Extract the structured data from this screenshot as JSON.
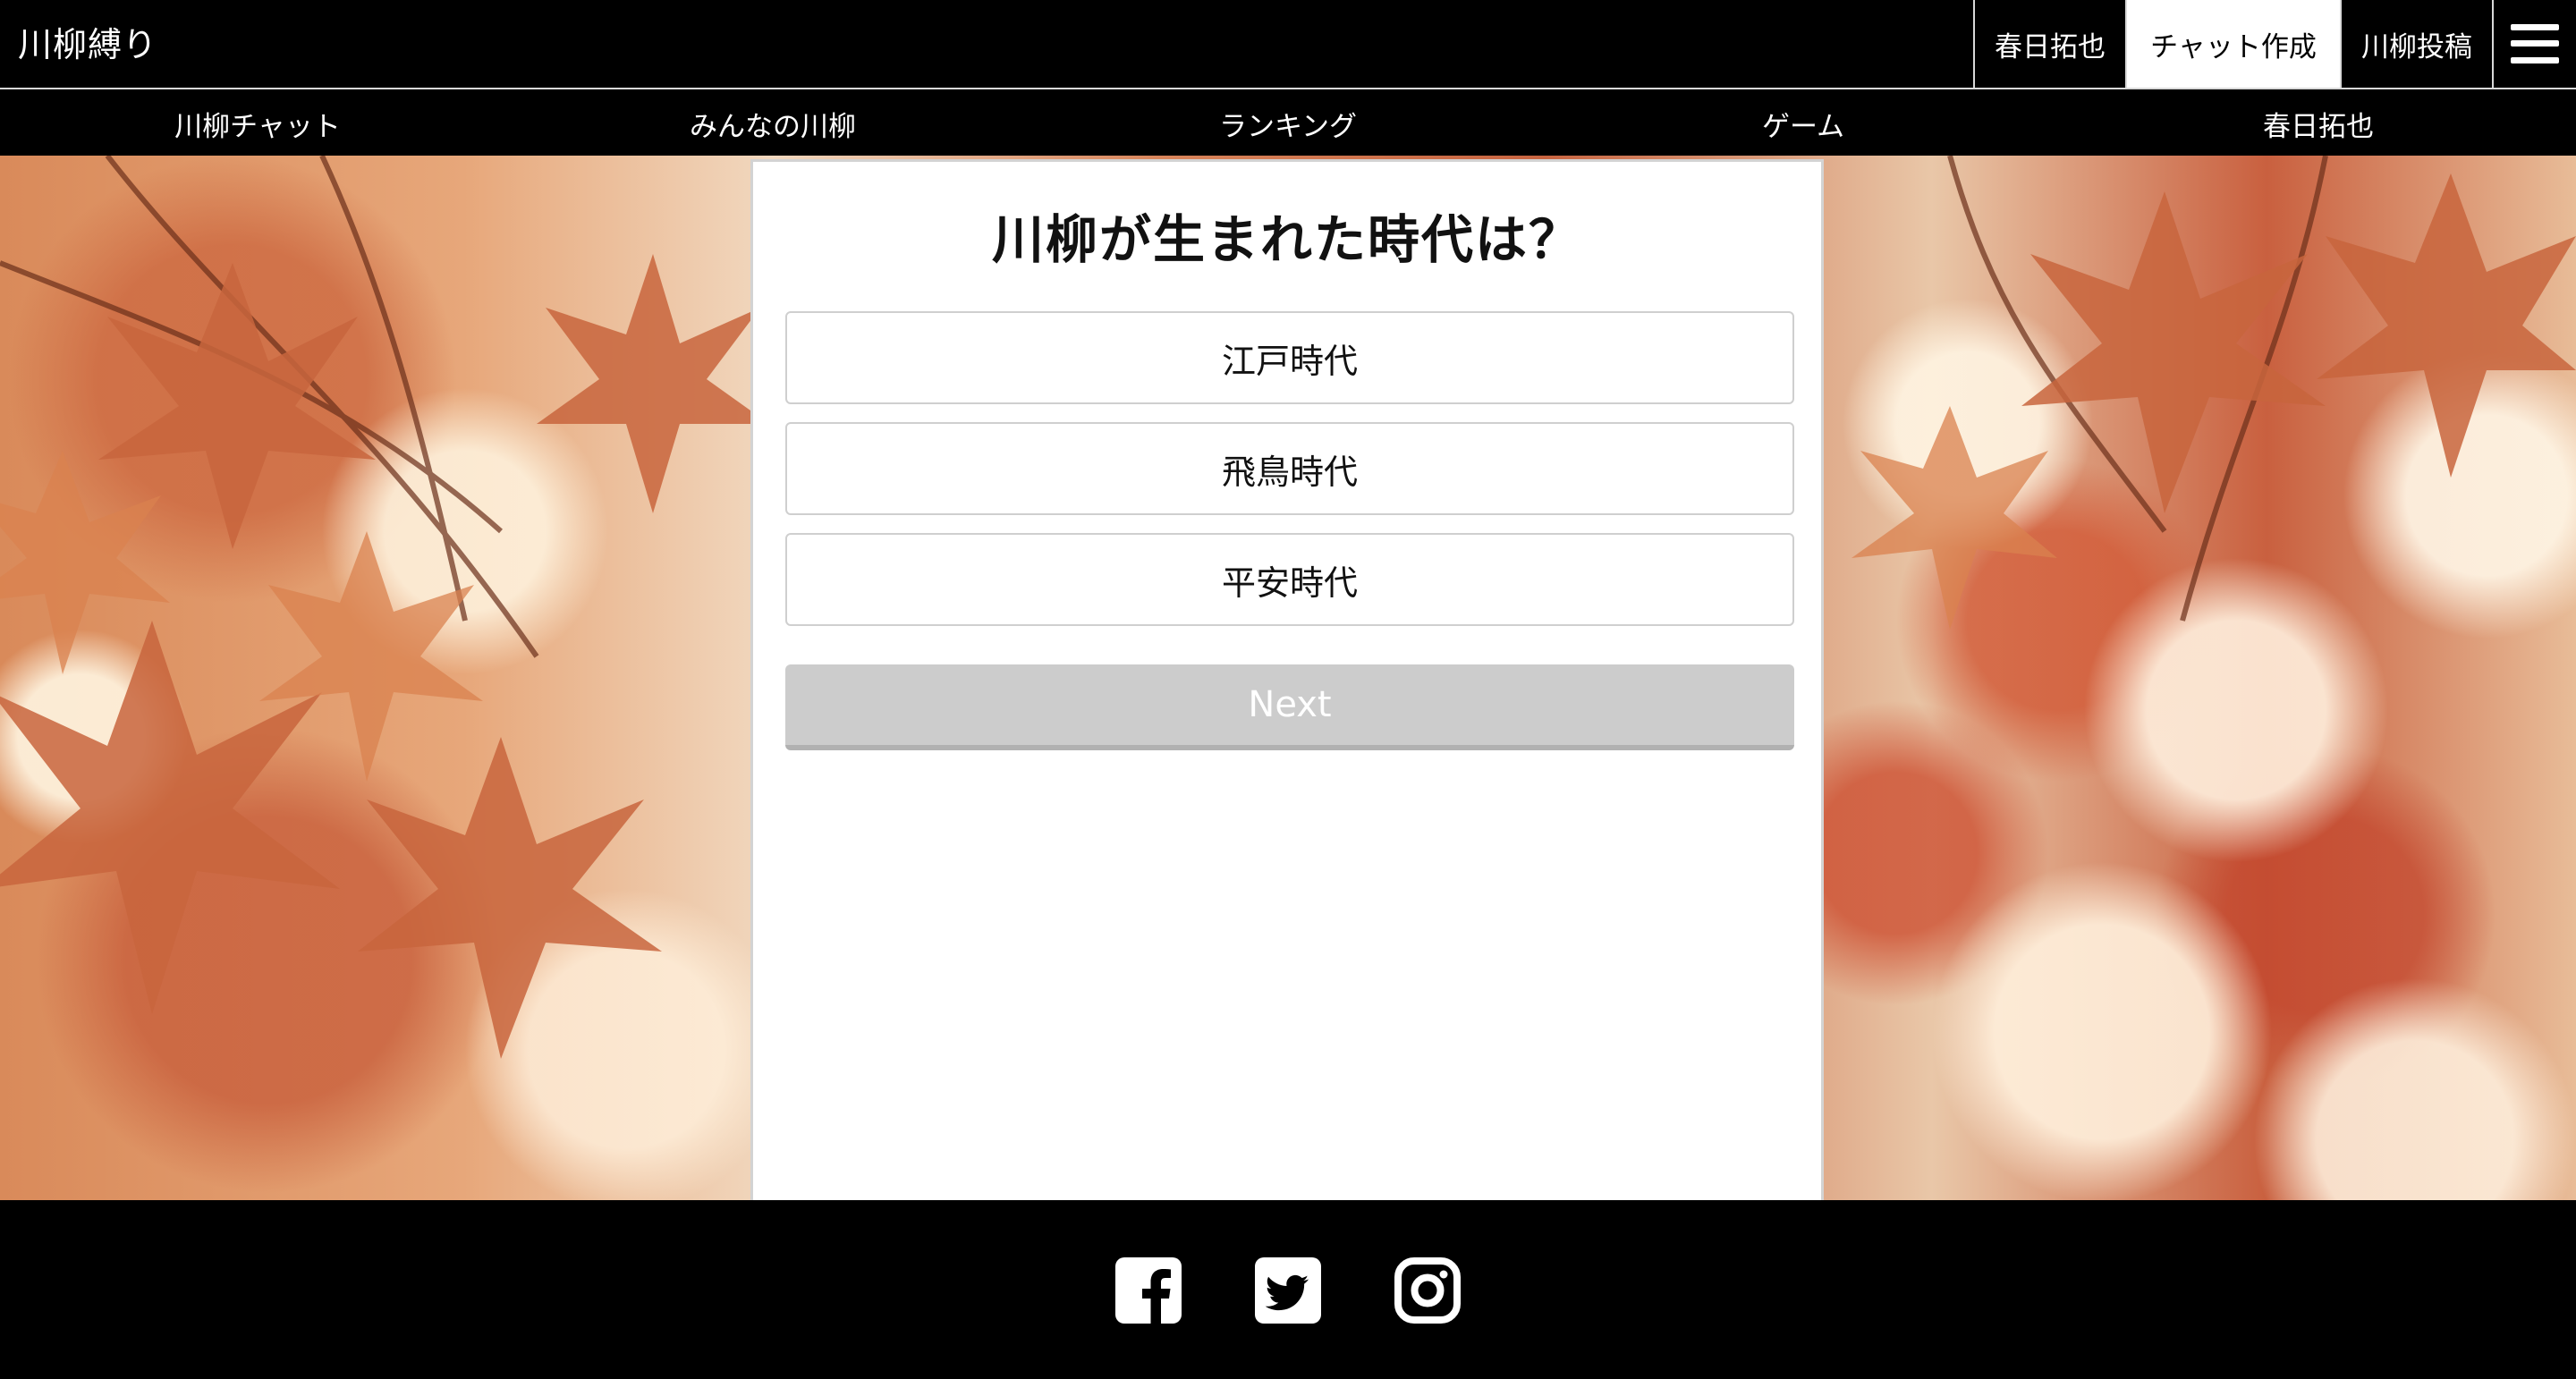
{
  "header": {
    "logo": "川柳縛り",
    "user_name": "春日拓也",
    "chat_create": "チャット作成",
    "senryu_post": "川柳投稿",
    "menu_icon": "hamburger-menu-icon"
  },
  "nav": {
    "items": [
      {
        "label": "川柳チャット"
      },
      {
        "label": "みんなの川柳"
      },
      {
        "label": "ランキング"
      },
      {
        "label": "ゲーム"
      },
      {
        "label": "春日拓也"
      }
    ]
  },
  "quiz": {
    "question": "川柳が生まれた時代は？",
    "options": [
      {
        "label": "江戸時代"
      },
      {
        "label": "飛鳥時代"
      },
      {
        "label": "平安時代"
      }
    ],
    "next_label": "Next"
  },
  "footer": {
    "social_icons": [
      "facebook-icon",
      "twitter-icon",
      "instagram-icon"
    ]
  },
  "colors": {
    "header_bg": "#000000",
    "active_tab_bg": "#ffffff",
    "next_button_bg": "#cccccc",
    "card_bg": "#ffffff"
  }
}
